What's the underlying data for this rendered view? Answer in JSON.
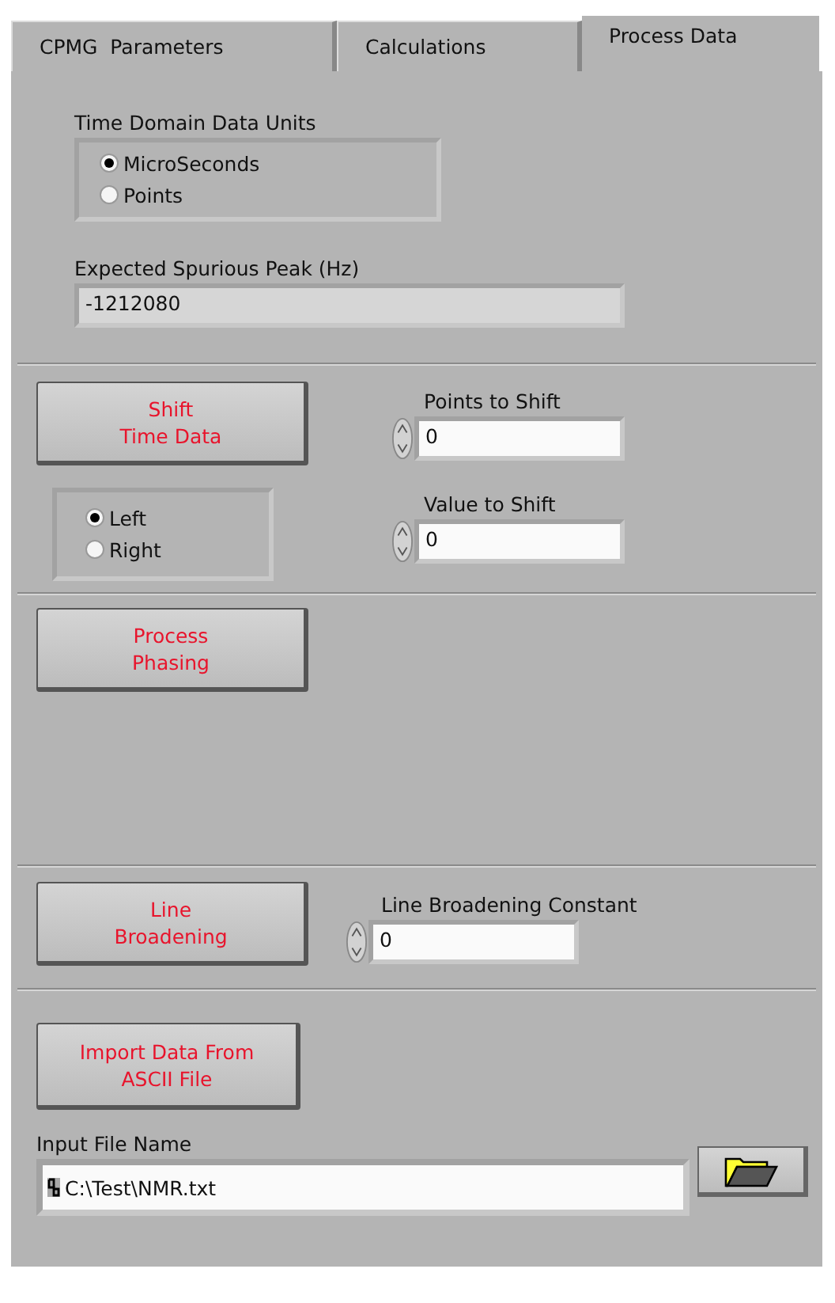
{
  "tabs": [
    {
      "label": "CPMG  Parameters",
      "selected": false
    },
    {
      "label": "Calculations",
      "selected": false
    },
    {
      "label": "Process Data",
      "selected": true
    }
  ],
  "time_units": {
    "label": "Time Domain Data Units",
    "options": [
      {
        "label": "MicroSeconds",
        "selected": true
      },
      {
        "label": "Points",
        "selected": false
      }
    ]
  },
  "spurious_peak": {
    "label": "Expected Spurious Peak (Hz)",
    "value": "-1212080"
  },
  "shift": {
    "button": "Shift\nTime Data",
    "direction": [
      {
        "label": "Left",
        "selected": true
      },
      {
        "label": "Right",
        "selected": false
      }
    ],
    "points": {
      "label": "Points to Shift",
      "value": "0"
    },
    "value": {
      "label": "Value to Shift",
      "value": "0"
    }
  },
  "phasing": {
    "button": "Process\nPhasing"
  },
  "broadening": {
    "button": "Line\nBroadening",
    "constant": {
      "label": "Line Broadening Constant",
      "value": "0"
    }
  },
  "import": {
    "button": "Import Data From\nASCII File",
    "file": {
      "label": "Input File Name",
      "value": "C:\\Test\\NMR.txt"
    }
  }
}
